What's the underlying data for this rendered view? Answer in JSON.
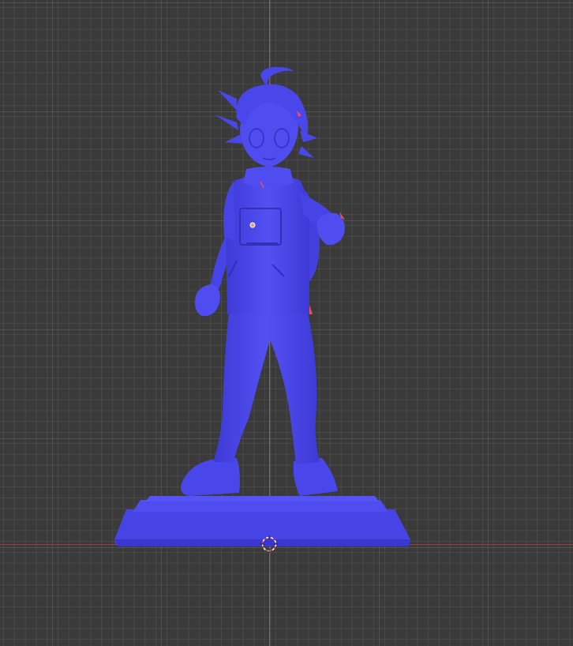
{
  "viewport": {
    "background": "#3a3a3a",
    "grid_color": "#4a4a4a",
    "x_axis_color": "#9b3a44",
    "y_axis_color": "#4f6fa8",
    "model_color": "#4b48ee",
    "model_shadow": "#3433c2",
    "accent_color": "#e8505e"
  },
  "objects": {
    "model": "figure-statue-icon",
    "cursor": "3d-cursor-icon",
    "origin": "object-origin-icon"
  }
}
